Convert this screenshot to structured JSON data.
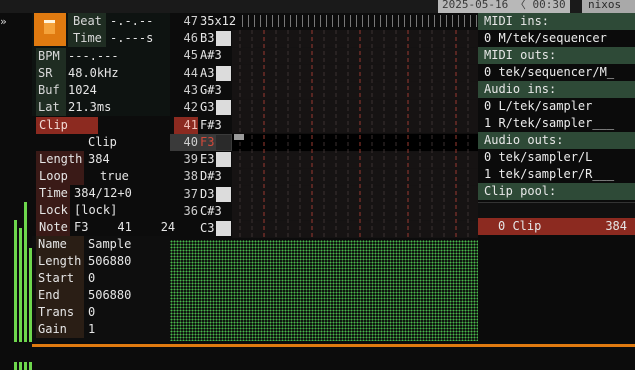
{
  "status": {
    "datetime": "2025-05-16 〈 00:30",
    "host": "nixos",
    "prompt": "»"
  },
  "transport": {
    "beat_label": "Beat",
    "beat_value": "-.-.--",
    "time_label": "Time",
    "time_value": "-.---s",
    "bpm_label": "BPM",
    "bpm_value": "---.---",
    "sr_label": "SR",
    "sr_value": "48.0kHz",
    "buf_label": "Buf",
    "buf_value": "1024",
    "lat_label": "Lat",
    "lat_value": "21.3ms"
  },
  "clip": {
    "header": "Clip",
    "name": "Clip",
    "length_label": "Length",
    "length_value": "384",
    "loop_label": "Loop",
    "loop_value": "true",
    "time_label": "Time",
    "time_value": "384/12+0",
    "lock_label": "Lock",
    "lock_value": "[lock]",
    "note_label": "Note",
    "note_value": "F3    41    24"
  },
  "sample": {
    "name_label": "Name",
    "name_value": "Sample",
    "length_label": "Length",
    "length_value": "506880",
    "start_label": "Start",
    "start_value": "0",
    "end_label": "End",
    "end_value": "506880",
    "trans_label": "Trans",
    "trans_value": "0",
    "gain_label": "Gain",
    "gain_value": "1"
  },
  "keyboard": {
    "zoom": "35x12",
    "top_num": "47",
    "rows": [
      {
        "num": "46",
        "note": "B3"
      },
      {
        "num": "45",
        "note": "A#3"
      },
      {
        "num": "44",
        "note": "A3"
      },
      {
        "num": "43",
        "note": "G#3"
      },
      {
        "num": "42",
        "note": "G3"
      },
      {
        "num": "41",
        "note": "F#3"
      },
      {
        "num": "40",
        "note": "F3"
      },
      {
        "num": "39",
        "note": "E3"
      },
      {
        "num": "38",
        "note": "D#3"
      },
      {
        "num": "37",
        "note": "D3"
      },
      {
        "num": "36",
        "note": "C#3"
      },
      {
        "num": "",
        "note": "C3"
      }
    ]
  },
  "io": {
    "midi_ins_label": "MIDI ins:",
    "midi_in_0": "0 M/tek/sequencer",
    "midi_outs_label": "MIDI outs:",
    "midi_out_0": "0 tek/sequencer/M_",
    "audio_ins_label": "Audio ins:",
    "audio_in_0": "0 L/tek/sampler",
    "audio_in_1": "1 R/tek/sampler___",
    "audio_outs_label": "Audio outs:",
    "audio_out_0": "0 tek/sampler/L",
    "audio_out_1": "1 tek/sampler/R___",
    "clip_pool_label": "Clip pool:",
    "pool_item_name": "0 Clip",
    "pool_item_len": "384"
  },
  "colors": {
    "accent_orange": "#e07a10",
    "label_green": "#1f2d22",
    "header_green": "#2e4a37",
    "highlight_red": "#8c2a20",
    "wave_green": "#49b84b"
  }
}
